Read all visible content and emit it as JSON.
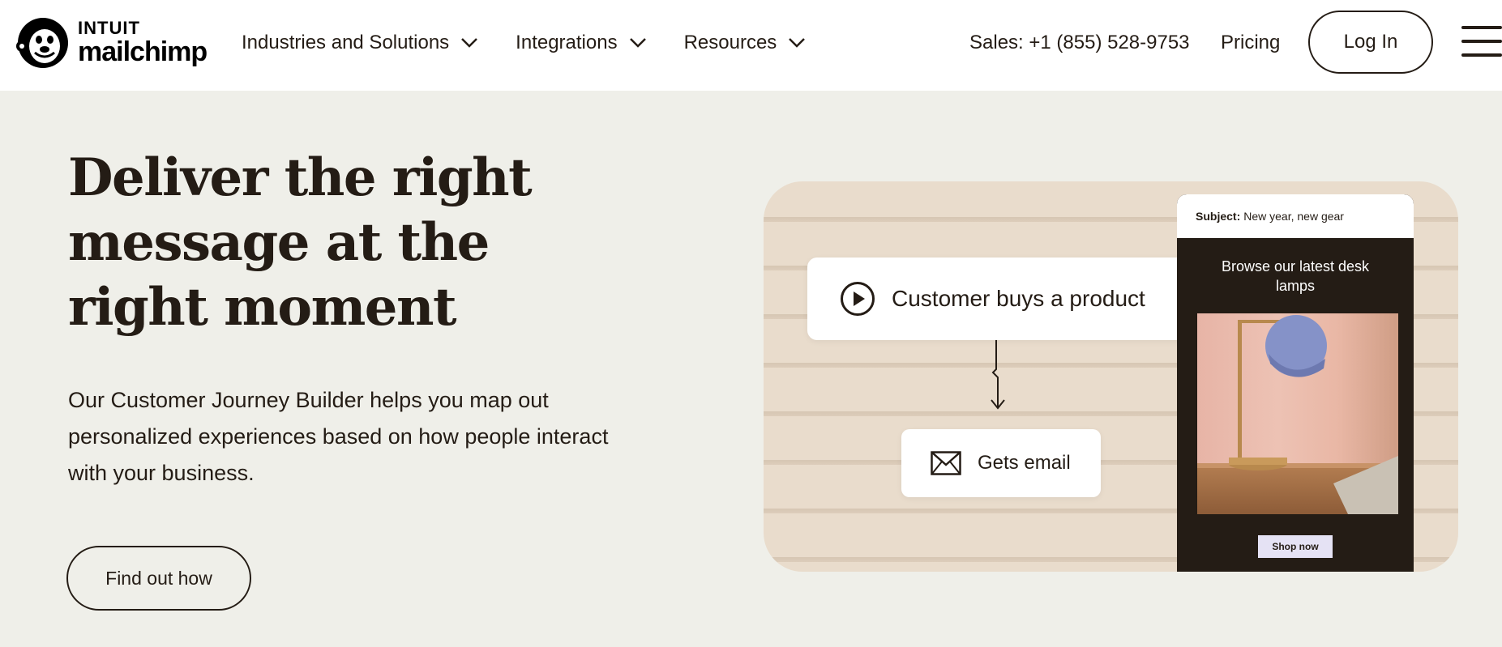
{
  "header": {
    "logo": {
      "top": "INTUIT",
      "bottom": "mailchimp"
    },
    "nav": [
      {
        "label": "Industries and Solutions"
      },
      {
        "label": "Integrations"
      },
      {
        "label": "Resources"
      }
    ],
    "sales": "Sales: +1 (855) 528-9753",
    "pricing": "Pricing",
    "login": "Log In"
  },
  "hero": {
    "headline": "Deliver the right message at the right moment",
    "subtext": "Our Customer Journey Builder helps you map out personalized experiences based on how people interact with your business.",
    "cta": "Find out how"
  },
  "illustration": {
    "trigger_card": "Customer buys a product",
    "action_card": "Gets email",
    "email": {
      "subject_label": "Subject:",
      "subject_value": "New year, new gear",
      "heading": "Browse our latest desk lamps",
      "button": "Shop now"
    }
  },
  "colors": {
    "text": "#241c15",
    "background": "#efefe9",
    "header_bg": "#ffffff",
    "email_bg": "#241c15",
    "lamp_shade": "#8592c8"
  }
}
